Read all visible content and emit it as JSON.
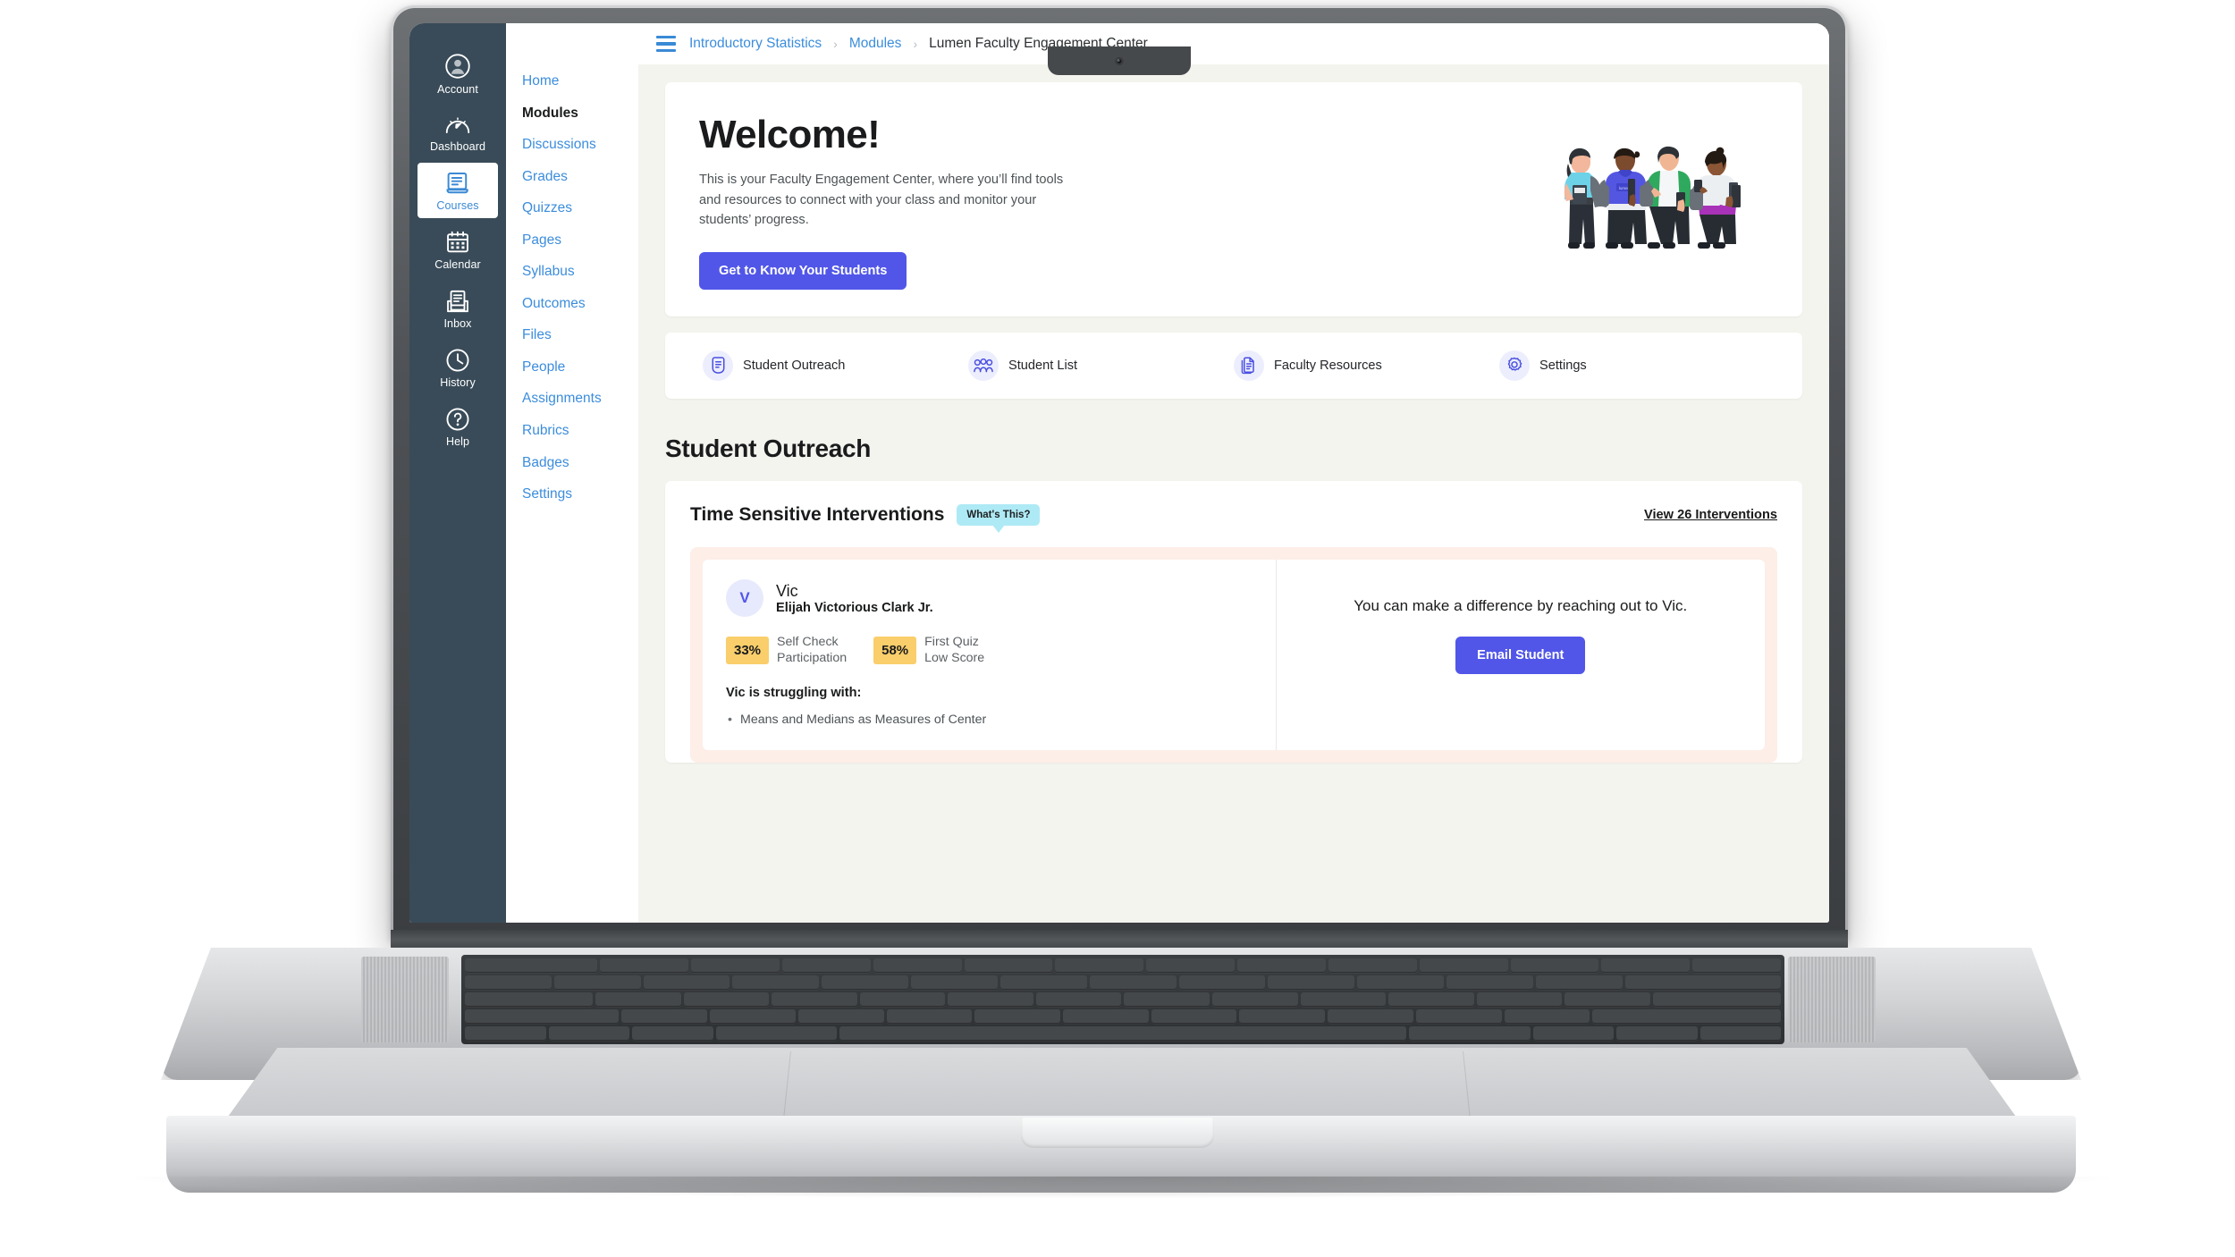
{
  "global_nav": {
    "items": [
      {
        "label": "Account",
        "icon": "account-circle-icon",
        "active": false
      },
      {
        "label": "Dashboard",
        "icon": "dashboard-gauge-icon",
        "active": false
      },
      {
        "label": "Courses",
        "icon": "courses-book-icon",
        "active": true
      },
      {
        "label": "Calendar",
        "icon": "calendar-icon",
        "active": false
      },
      {
        "label": "Inbox",
        "icon": "inbox-tray-icon",
        "active": false
      },
      {
        "label": "History",
        "icon": "history-clock-icon",
        "active": false
      },
      {
        "label": "Help",
        "icon": "help-question-icon",
        "active": false
      }
    ]
  },
  "course_nav": {
    "items": [
      {
        "label": "Home",
        "active": false
      },
      {
        "label": "Modules",
        "active": true
      },
      {
        "label": "Discussions",
        "active": false
      },
      {
        "label": "Grades",
        "active": false
      },
      {
        "label": "Quizzes",
        "active": false
      },
      {
        "label": "Pages",
        "active": false
      },
      {
        "label": "Syllabus",
        "active": false
      },
      {
        "label": "Outcomes",
        "active": false
      },
      {
        "label": "Files",
        "active": false
      },
      {
        "label": "People",
        "active": false
      },
      {
        "label": "Assignments",
        "active": false
      },
      {
        "label": "Rubrics",
        "active": false
      },
      {
        "label": "Badges",
        "active": false
      },
      {
        "label": "Settings",
        "active": false
      }
    ]
  },
  "breadcrumb": {
    "menu_icon": "hamburger-menu-icon",
    "items": [
      {
        "label": "Introductory Statistics",
        "current": false
      },
      {
        "label": "Modules",
        "current": false
      },
      {
        "label": "Lumen Faculty Engagement Center",
        "current": true
      }
    ],
    "separator": "›"
  },
  "hero": {
    "title": "Welcome!",
    "body": "This is your Faculty Engagement Center, where you’ll find tools and resources to connect with your class and monitor your students’ progress.",
    "cta_label": "Get to Know Your Students",
    "illustration": "four-students-illustration"
  },
  "quick_links": [
    {
      "label": "Student Outreach",
      "icon": "outreach-document-icon"
    },
    {
      "label": "Student List",
      "icon": "people-group-icon"
    },
    {
      "label": "Faculty Resources",
      "icon": "documents-stack-icon"
    },
    {
      "label": "Settings",
      "icon": "gear-icon"
    }
  ],
  "outreach": {
    "section_title": "Student Outreach",
    "panel_title": "Time Sensitive Interventions",
    "whats_this_label": "What's This?",
    "view_link_label": "View 26 Interventions",
    "student": {
      "avatar_initial": "V",
      "nickname": "Vic",
      "full_name": "Elijah Victorious Clark Jr.",
      "stats": [
        {
          "value": "33%",
          "line1": "Self Check",
          "line2": "Participation"
        },
        {
          "value": "58%",
          "line1": "First Quiz",
          "line2": "Low Score"
        }
      ],
      "struggling_heading": "Vic is struggling with:",
      "struggling_items": [
        "Means and Medians as Measures of Center"
      ],
      "encouragement": "You can make a difference by reaching out to Vic.",
      "email_button_label": "Email Student"
    }
  },
  "colors": {
    "canvas_nav_bg": "#394b58",
    "link_blue": "#3c8ddc",
    "accent_indigo": "#5156e8",
    "badge_yellow": "#f9ce6b",
    "tooltip_cyan": "#aeeaf5",
    "intervention_peach": "#fdeee7",
    "page_bg": "#f4f4ef"
  }
}
